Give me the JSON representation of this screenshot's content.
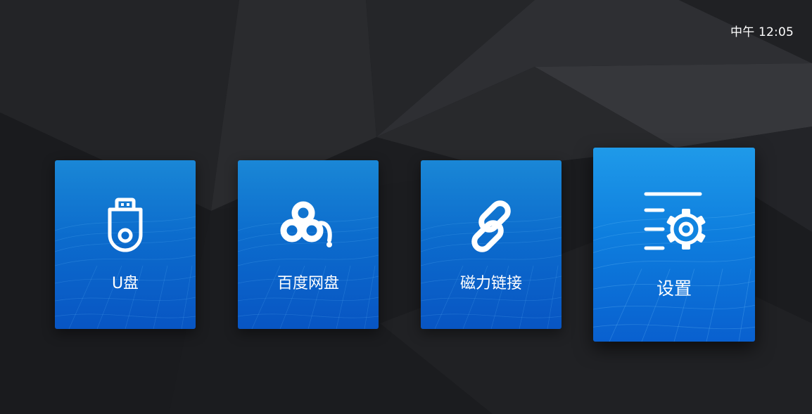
{
  "status_bar": {
    "time": "中午 12:05"
  },
  "tiles": [
    {
      "label": "U盘",
      "icon": "usb-drive-icon"
    },
    {
      "label": "百度网盘",
      "icon": "baidu-netdisk-icon"
    },
    {
      "label": "磁力链接",
      "icon": "link-icon"
    },
    {
      "label": "设置",
      "icon": "settings-gear-icon",
      "focused": true
    }
  ],
  "colors": {
    "background": "#1d1e21",
    "tile_blue": "#0c6ccd",
    "tile_blue_focused": "#0e7ede",
    "text": "#ffffff"
  }
}
